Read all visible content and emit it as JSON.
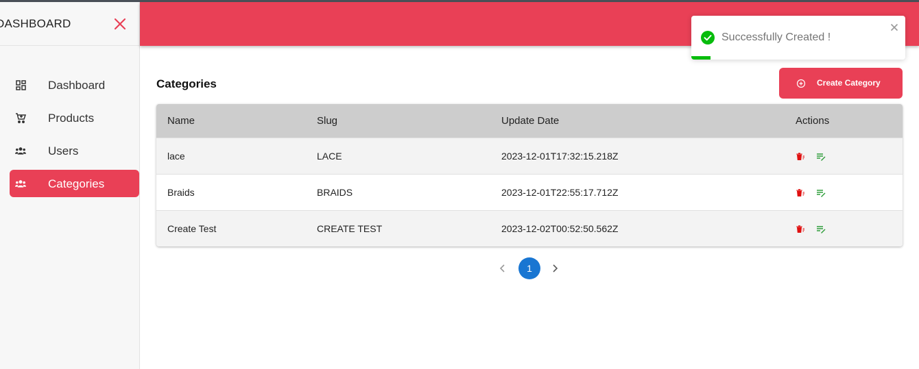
{
  "sidebar": {
    "title": "DASHBOARD",
    "items": [
      {
        "label": "Dashboard",
        "icon": "dashboard-grid-icon",
        "active": false
      },
      {
        "label": "Products",
        "icon": "cart-icon",
        "active": false
      },
      {
        "label": "Users",
        "icon": "users-icon",
        "active": false
      },
      {
        "label": "Categories",
        "icon": "users-icon",
        "active": true
      }
    ]
  },
  "main": {
    "title": "Categories",
    "create_button": "Create Category",
    "table": {
      "columns": [
        "Name",
        "Slug",
        "Update Date",
        "Actions"
      ],
      "rows": [
        {
          "name": "lace",
          "slug": "LACE",
          "updated": "2023-12-01T17:32:15.218Z"
        },
        {
          "name": "Braids",
          "slug": "BRAIDS",
          "updated": "2023-12-01T22:55:17.712Z"
        },
        {
          "name": "Create Test",
          "slug": "CREATE TEST",
          "updated": "2023-12-02T00:52:50.562Z"
        }
      ]
    },
    "pagination": {
      "current_page": "1"
    }
  },
  "toast": {
    "message": "Successfully Created !",
    "type": "success",
    "progress": 0.09
  },
  "colors": {
    "accent": "#e94056",
    "success": "#07bc0c",
    "pagination": "#1976d2",
    "delete_icon": "#e01010",
    "edit_icon": "#2e9d3a"
  }
}
